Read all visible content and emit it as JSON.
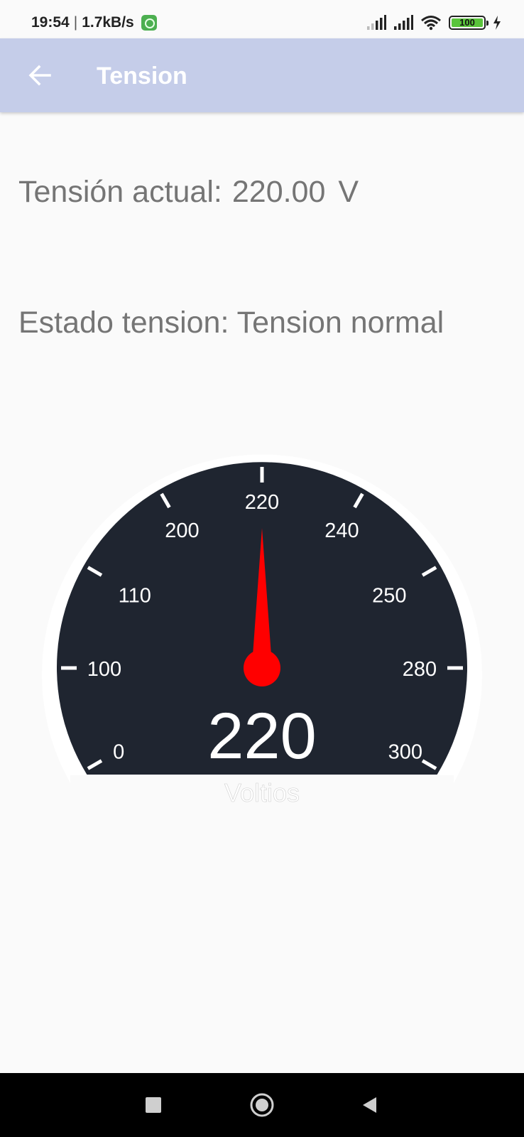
{
  "status_bar": {
    "time": "19:54",
    "network_speed": "1.7kB/s",
    "battery_level": "100",
    "icons": [
      "app-notification-icon",
      "signal-1-icon",
      "signal-2-icon",
      "wifi-icon",
      "battery-icon",
      "charging-icon"
    ]
  },
  "app_bar": {
    "title": "Tension",
    "back_icon": "arrow-left-icon",
    "background_color": "#c5cde9"
  },
  "info": {
    "current_label": "Tensión actual:",
    "current_value": "220.00",
    "current_unit": "V",
    "state_label": "Estado tension:",
    "state_value": "Tension normal"
  },
  "gauge": {
    "value": 220,
    "value_text": "220",
    "unit_label": "Voltios",
    "tick_labels": [
      "0",
      "100",
      "110",
      "200",
      "220",
      "240",
      "250",
      "280",
      "300"
    ],
    "face_color": "#1f2530",
    "needle_color": "#ff0000"
  },
  "nav_bar": {
    "icons": [
      "recent-apps-icon",
      "home-icon",
      "back-icon"
    ]
  }
}
